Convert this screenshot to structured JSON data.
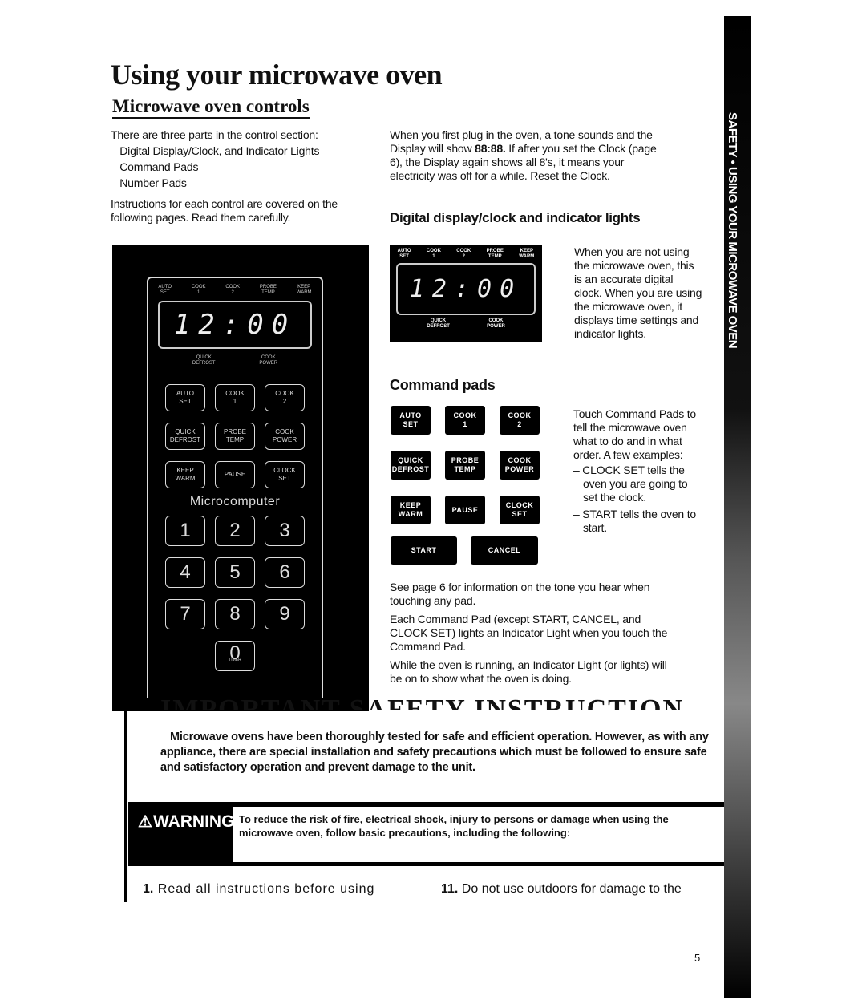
{
  "title": "Using your microwave oven",
  "subtitle": "Microwave oven controls",
  "intro": {
    "lead": "There are three parts in the control section:",
    "items": [
      "– Digital Display/Clock, and Indicator Lights",
      "– Command Pads",
      "– Number Pads"
    ],
    "note": "Instructions for each control are covered on the following pages. Read them carefully."
  },
  "plug_text_a": "When you first plug in the oven, a tone sounds and the Display will show ",
  "plug_bold": "88:88.",
  "plug_text_b": " If after you set the Clock (page 6), the Display again shows all 8's, it means your electricity was off for a while. Reset the Clock.",
  "display_section": {
    "heading": "Digital display/clock and indicator lights",
    "text": "When you are not using the microwave oven, this is an accurate digital clock. When you are using the microwave oven, it displays time settings and indicator lights.",
    "top_labels": [
      [
        "AUTO",
        "SET"
      ],
      [
        "COOK",
        "1"
      ],
      [
        "COOK",
        "2"
      ],
      [
        "PROBE",
        "TEMP"
      ],
      [
        "KEEP",
        "WARM"
      ]
    ],
    "bottom_labels": [
      [
        "QUICK",
        "DEFROST"
      ],
      [
        "COOK",
        "POWER"
      ]
    ],
    "time": "12:00"
  },
  "command_section": {
    "heading": "Command pads",
    "text": "Touch Command Pads to tell the microwave oven what to do and in what order. A few examples:",
    "examples": [
      "– CLOCK SET tells the oven you are going to set the clock.",
      "– START tells the oven to start."
    ],
    "pads": [
      [
        "AUTO",
        "SET"
      ],
      [
        "COOK",
        "1"
      ],
      [
        "COOK",
        "2"
      ],
      [
        "QUICK",
        "DEFROST"
      ],
      [
        "PROBE",
        "TEMP"
      ],
      [
        "COOK",
        "POWER"
      ],
      [
        "KEEP",
        "WARM"
      ],
      [
        "PAUSE",
        ""
      ],
      [
        "CLOCK",
        "SET"
      ]
    ],
    "start": "START",
    "cancel": "CANCEL"
  },
  "paras": [
    "See page 6 for information on the tone you hear when touching any pad.",
    "Each Command Pad (except START, CANCEL, and CLOCK SET) lights an Indicator Light when you touch the Command Pad.",
    "While the oven is running, an Indicator Light (or lights) will be on to show what the oven is doing."
  ],
  "panel": {
    "brand": "Microcomputer",
    "numbers": [
      "1",
      "2",
      "3",
      "4",
      "5",
      "6",
      "7",
      "8",
      "9",
      "0"
    ],
    "zero_sub": "TIMER"
  },
  "safety": {
    "heading": "IMPORTANT SAFETY INSTRUCTIONS",
    "intro": "Microwave ovens have been thoroughly tested for safe and efficient operation. However, as with any appliance, there are special installation and safety precautions which must be followed to ensure safe and satisfactory operation and prevent damage to the unit.",
    "warning_label": "WARNING",
    "warning_text": "To reduce the risk of fire, electrical shock, injury to persons or damage when using the microwave oven, follow basic precautions, including the following:",
    "item1_num": "1.",
    "item1": " Read all instructions before using",
    "item11_num": "11.",
    "item11": " Do not use outdoors for damage to the"
  },
  "side_tab": "SAFETY • USING YOUR MICROWAVE OVEN",
  "page_number": "5"
}
